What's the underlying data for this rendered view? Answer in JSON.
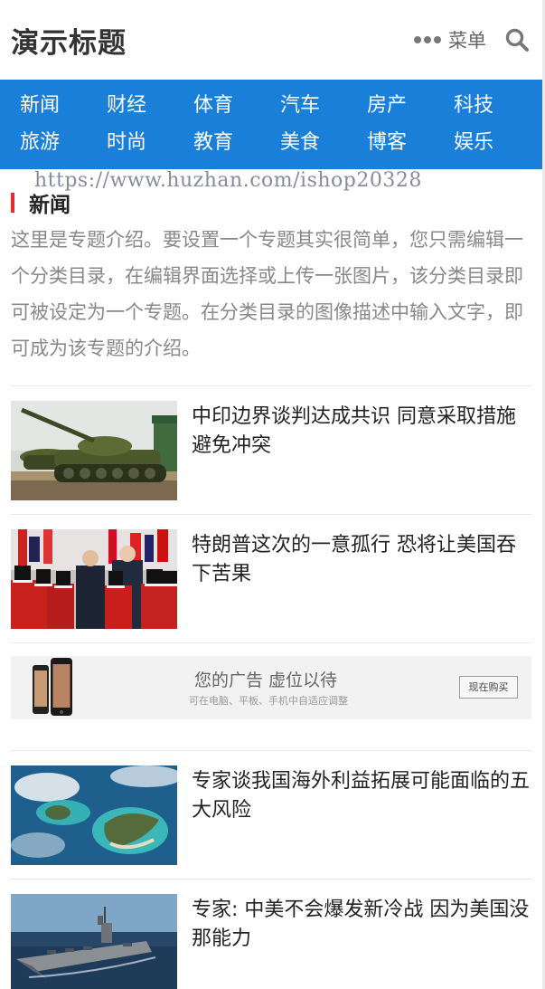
{
  "header": {
    "site_title": "演示标题",
    "menu_label": "菜单",
    "search_icon": "search-icon",
    "menu_icon": "more-dots-icon"
  },
  "nav": {
    "watermark": "https://www.huzhan.com/ishop20328",
    "items": [
      {
        "label": "新闻"
      },
      {
        "label": "财经"
      },
      {
        "label": "体育"
      },
      {
        "label": "汽车"
      },
      {
        "label": "房产"
      },
      {
        "label": "科技"
      },
      {
        "label": "旅游"
      },
      {
        "label": "时尚"
      },
      {
        "label": "教育"
      },
      {
        "label": "美食"
      },
      {
        "label": "博客"
      },
      {
        "label": "娱乐"
      }
    ]
  },
  "section": {
    "name": "新闻",
    "intro": "这里是专题介绍。要设置一个专题其实很简单，您只需编辑一个分类目录，在编辑界面选择或上传一张图片，该分类目录即可被设定为一个专题。在分类目录的图像描述中输入文字，即可成为该专题的介绍。"
  },
  "articles": [
    {
      "title": "中印边界谈判达成共识 同意采取措施避免冲突"
    },
    {
      "title": "特朗普这次的一意孤行 恐将让美国吞下苦果"
    },
    {
      "title": "专家谈我国海外利益拓展可能面临的五大风险"
    },
    {
      "title": "专家: 中美不会爆发新冷战 因为美国没那能力"
    }
  ],
  "ad": {
    "main_text": "您的广告 虚位以待",
    "sub_text": "可在电脑、平板、手机中自适应调整",
    "button_label": "现在购买"
  },
  "colors": {
    "nav_bg": "#1a7fd8",
    "accent_bar": "#e02d2d"
  }
}
